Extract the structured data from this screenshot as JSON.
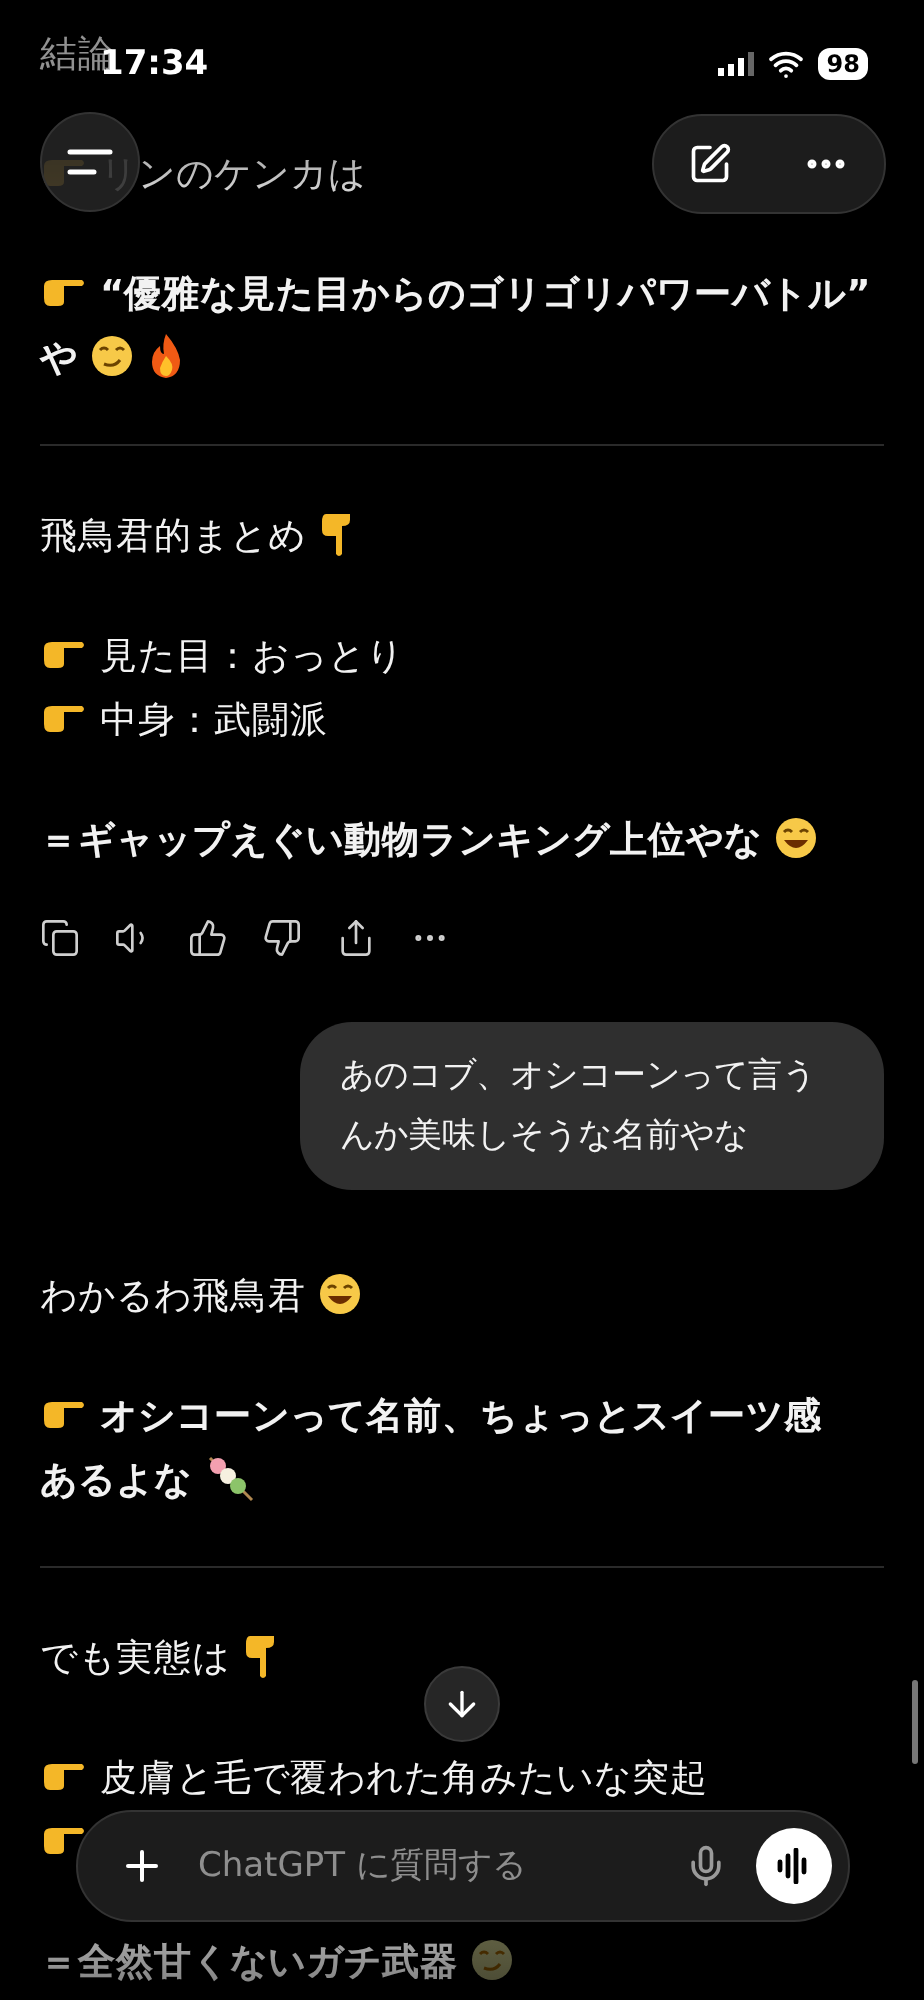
{
  "status_bar": {
    "time": "17:34",
    "battery": "98"
  },
  "blocks": [
    {
      "kind": "para",
      "lines": [
        {
          "text": "結論",
          "pointer": false,
          "bold": false
        }
      ]
    },
    {
      "kind": "para",
      "lines": [
        {
          "text": "リンのケンカは",
          "pointer": true,
          "bold": false
        }
      ]
    },
    {
      "kind": "para",
      "lines": [
        {
          "text": "“優雅な見た目からのゴリゴリパワーバトル”",
          "pointer": true,
          "bold": true
        },
        {
          "text": "や",
          "pointer": false,
          "bold": true
        }
      ]
    },
    {
      "kind": "divider"
    },
    {
      "kind": "para",
      "lines": [
        {
          "text": "飛鳥君的まとめ",
          "pointer": false,
          "bold": false
        }
      ]
    },
    {
      "kind": "para",
      "lines": [
        {
          "text": "見た目：おっとり",
          "pointer": true,
          "bold": false
        },
        {
          "text": "中身：武闘派",
          "pointer": true,
          "bold": false
        }
      ]
    },
    {
      "kind": "para",
      "lines": [
        {
          "text": "＝ギャップえぐい動物ランキング上位やな",
          "pointer": false,
          "bold": true
        }
      ]
    },
    {
      "kind": "actions"
    },
    {
      "kind": "bubble",
      "text": "あのコブ、オシコーンって言うんか美味しそうな名前やな"
    },
    {
      "kind": "para",
      "lines": [
        {
          "text": "わかるわ飛鳥君",
          "pointer": false,
          "bold": false
        }
      ]
    },
    {
      "kind": "para",
      "lines": [
        {
          "text": "オシコーンって名前、ちょっとスイーツ感",
          "pointer": true,
          "bold": true
        },
        {
          "text": "あるよな",
          "pointer": false,
          "bold": true
        }
      ]
    },
    {
      "kind": "divider"
    },
    {
      "kind": "para",
      "lines": [
        {
          "text": "でも実態は",
          "pointer": false,
          "bold": false
        }
      ]
    },
    {
      "kind": "para",
      "lines": [
        {
          "text": "皮膚と毛で覆われた角みたいな突起",
          "pointer": true,
          "bold": false
        },
        {
          "pointer": true
        }
      ]
    },
    {
      "kind": "para",
      "lines": [
        {
          "text": "＝全然甘くないガチ武器",
          "pointer": false,
          "bold": true
        }
      ]
    }
  ],
  "composer": {
    "placeholder": "ChatGPT に質問する"
  }
}
